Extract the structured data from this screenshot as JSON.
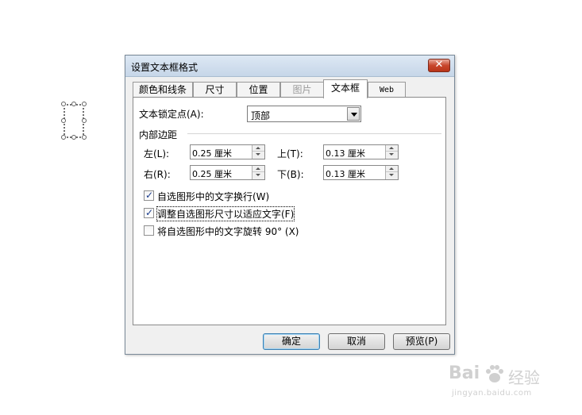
{
  "dialog": {
    "title": "设置文本框格式",
    "close_label": "✕"
  },
  "tabs": [
    {
      "label": "颜色和线条",
      "state": "normal"
    },
    {
      "label": "尺寸",
      "state": "normal"
    },
    {
      "label": "位置",
      "state": "normal"
    },
    {
      "label": "图片",
      "state": "disabled"
    },
    {
      "label": "文本框",
      "state": "active"
    },
    {
      "label": "Web",
      "state": "normal"
    }
  ],
  "anchor": {
    "label": "文本锁定点(A):",
    "value": "顶部"
  },
  "margins": {
    "group_label": "内部边距",
    "left_label": "左(L):",
    "left_value": "0.25 厘米",
    "top_label": "上(T):",
    "top_value": "0.13 厘米",
    "right_label": "右(R):",
    "right_value": "0.25 厘米",
    "bottom_label": "下(B):",
    "bottom_value": "0.13 厘米"
  },
  "options": [
    {
      "label": "自选图形中的文字换行(W)",
      "checked": true
    },
    {
      "label": "调整自选图形尺寸以适应文字(F)",
      "checked": true
    },
    {
      "label": "将自选图形中的文字旋转 90° (X)",
      "checked": false
    }
  ],
  "buttons": {
    "ok": "确定",
    "cancel": "取消",
    "preview": "预览(P)"
  },
  "watermark": {
    "brand": "Bai",
    "text": "经验",
    "url": "jingyan.baidu.com"
  },
  "colors": {
    "title_gradient_top": "#dde8f4",
    "close_red": "#c8462c",
    "default_button_border": "#3c7fb1"
  }
}
